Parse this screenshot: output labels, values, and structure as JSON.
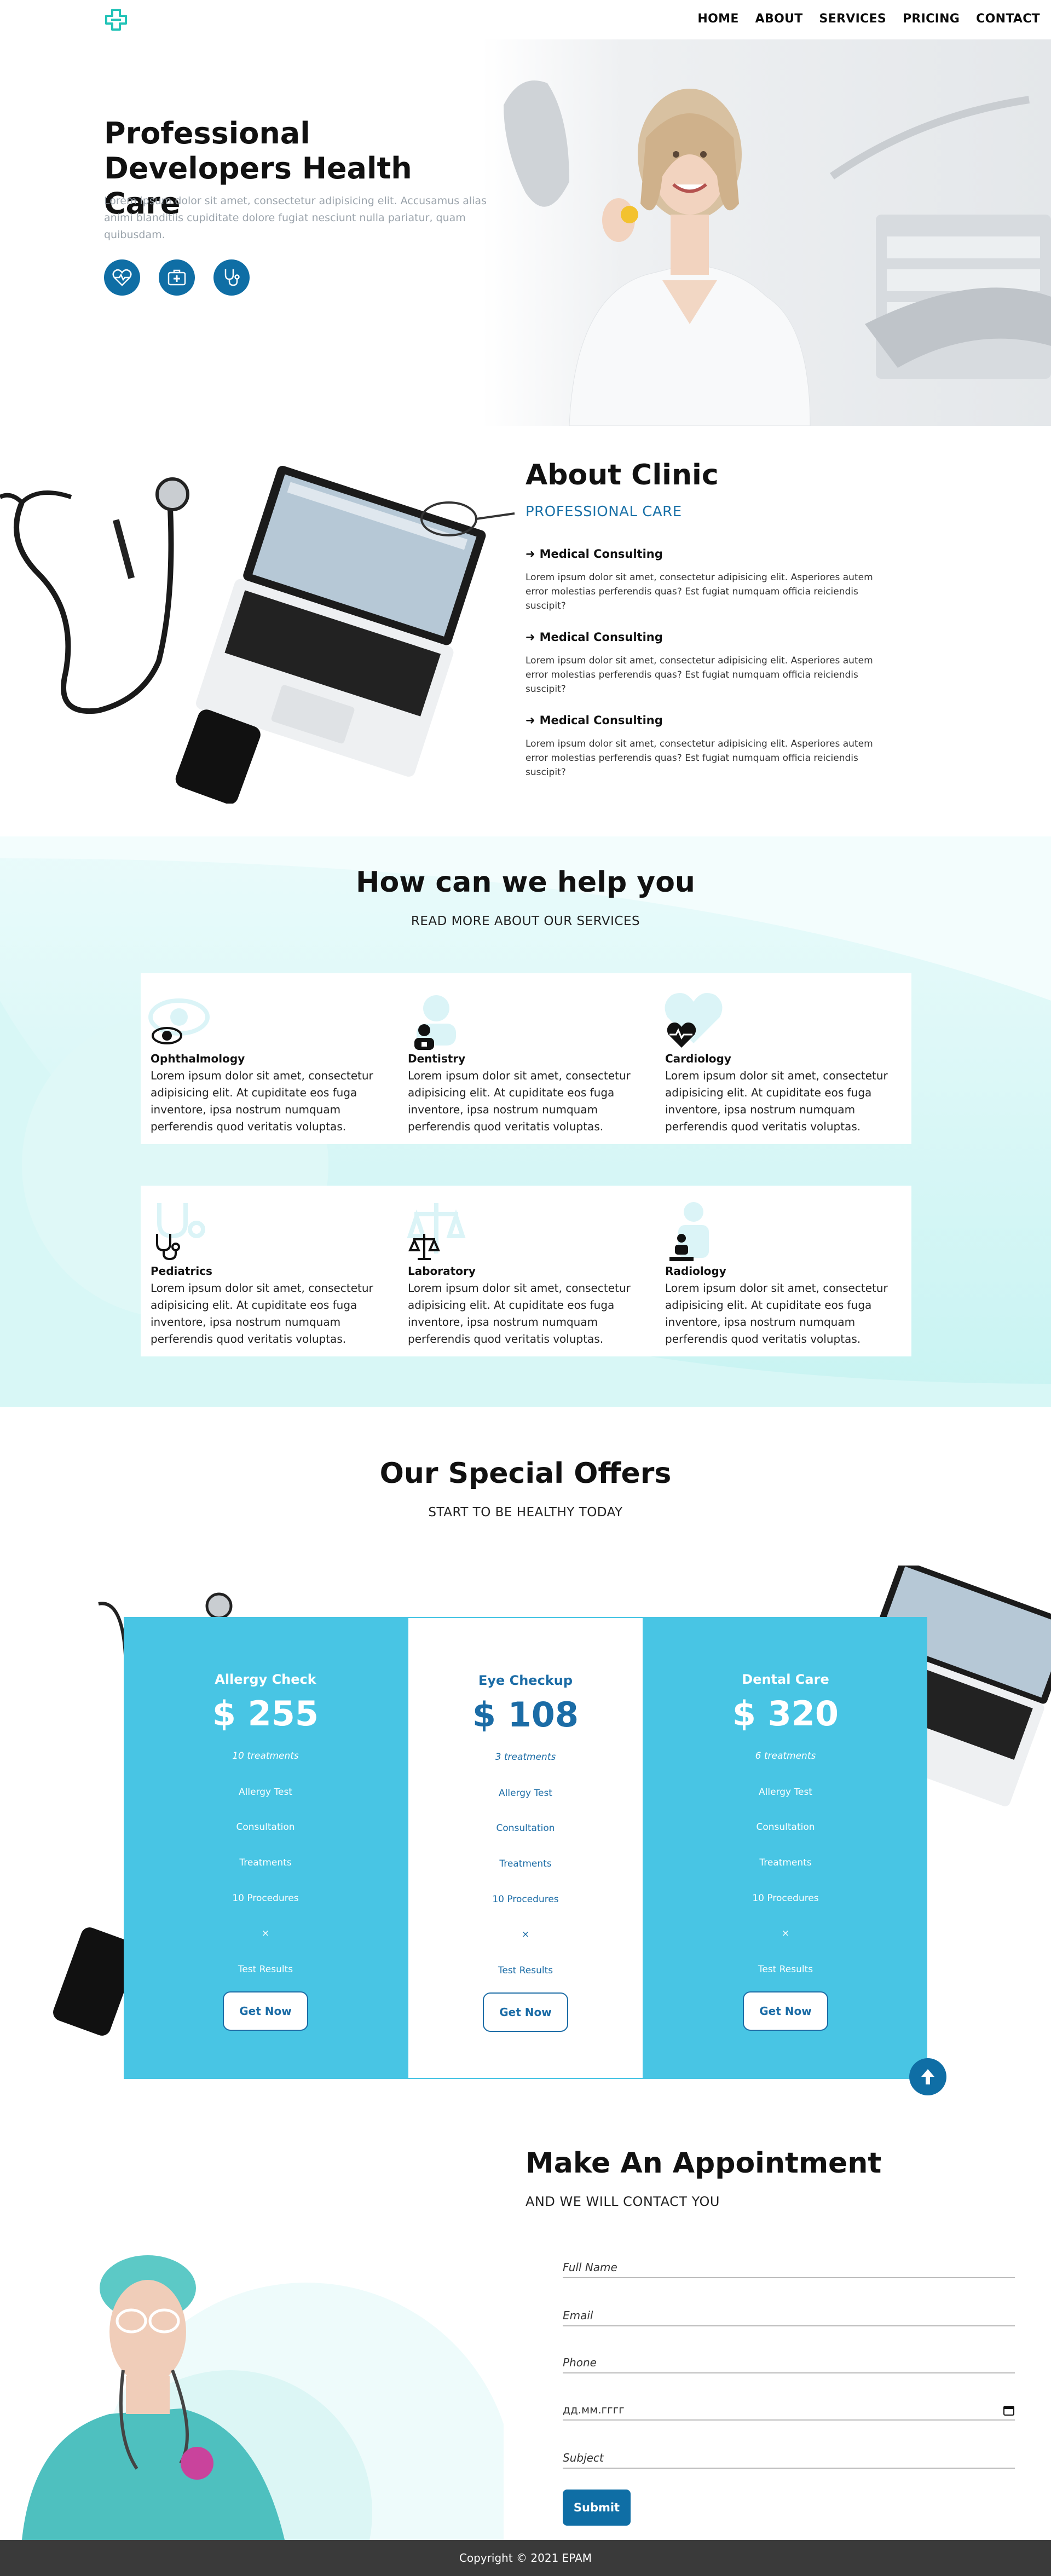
{
  "nav": {
    "logo_icon": "medical-cross-icon",
    "items": [
      "HOME",
      "ABOUT",
      "SERVICES",
      "PRICING",
      "CONTACT"
    ]
  },
  "hero": {
    "title": "Professional Developers Health Care",
    "text": "Lorem ipsum dolor sit amet, consectetur adipisicing elit. Accusamus alias animi blanditiis cupiditate dolore fugiat nesciunt nulla pariatur, quam quibusdam.",
    "icons": [
      "heart-rate-icon",
      "medical-kit-icon",
      "stethoscope-icon"
    ]
  },
  "about": {
    "title": "About Clinic",
    "subtitle": "PROFESSIONAL CARE",
    "items": [
      {
        "title": "Medical Consulting",
        "text": "Lorem ipsum dolor sit amet, consectetur adipisicing elit. Asperiores autem error molestias perferendis quas? Est fugiat numquam officia reiciendis suscipit?"
      },
      {
        "title": "Medical Consulting",
        "text": "Lorem ipsum dolor sit amet, consectetur adipisicing elit. Asperiores autem error molestias perferendis quas? Est fugiat numquam officia reiciendis suscipit?"
      },
      {
        "title": "Medical Consulting",
        "text": "Lorem ipsum dolor sit amet, consectetur adipisicing elit. Asperiores autem error molestias perferendis quas? Est fugiat numquam officia reiciendis suscipit?"
      }
    ]
  },
  "help": {
    "title": "How can we help you",
    "subtitle": "READ MORE ABOUT OUR SERVICES",
    "services": [
      {
        "name": "Ophthalmology",
        "icon": "eye-icon",
        "text": "Lorem ipsum dolor sit amet, consectetur adipisicing elit. At cupiditate eos fuga inventore, ipsa nostrum numquam perferendis quod veritatis voluptas."
      },
      {
        "name": "Dentistry",
        "icon": "dentist-icon",
        "text": "Lorem ipsum dolor sit amet, consectetur adipisicing elit. At cupiditate eos fuga inventore, ipsa nostrum numquam perferendis quod veritatis voluptas."
      },
      {
        "name": "Cardiology",
        "icon": "heartbeat-icon",
        "text": "Lorem ipsum dolor sit amet, consectetur adipisicing elit. At cupiditate eos fuga inventore, ipsa nostrum numquam perferendis quod veritatis voluptas."
      },
      {
        "name": "Pediatrics",
        "icon": "stethoscope-icon",
        "text": "Lorem ipsum dolor sit amet, consectetur adipisicing elit. At cupiditate eos fuga inventore, ipsa nostrum numquam perferendis quod veritatis voluptas."
      },
      {
        "name": "Laboratory",
        "icon": "balance-scale-icon",
        "text": "Lorem ipsum dolor sit amet, consectetur adipisicing elit. At cupiditate eos fuga inventore, ipsa nostrum numquam perferendis quod veritatis voluptas."
      },
      {
        "name": "Radiology",
        "icon": "x-ray-person-icon",
        "text": "Lorem ipsum dolor sit amet, consectetur adipisicing elit. At cupiditate eos fuga inventore, ipsa nostrum numquam perferendis quod veritatis voluptas."
      }
    ]
  },
  "offers": {
    "title": "Our Special Offers",
    "subtitle": "START TO BE HEALTHY TODAY",
    "plans": [
      {
        "name": "Allergy Check",
        "price": "$ 255",
        "treatments": "10 treatments",
        "lines": [
          "Allergy Test",
          "Consultation",
          "Treatments",
          "10 Procedures",
          "×",
          "Test Results"
        ],
        "button": "Get Now"
      },
      {
        "name": "Eye Checkup",
        "price": "$ 108",
        "treatments": "3 treatments",
        "lines": [
          "Allergy Test",
          "Consultation",
          "Treatments",
          "10 Procedures",
          "×",
          "Test Results"
        ],
        "button": "Get Now"
      },
      {
        "name": "Dental Care",
        "price": "$ 320",
        "treatments": "6 treatments",
        "lines": [
          "Allergy Test",
          "Consultation",
          "Treatments",
          "10 Procedures",
          "×",
          "Test Results"
        ],
        "button": "Get Now"
      }
    ],
    "scroll_top_icon": "arrow-up-icon"
  },
  "appointment": {
    "title": "Make An Appointment",
    "subtitle": "AND WE WILL CONTACT YOU",
    "fields": {
      "full_name": "Full Name",
      "email": "Email",
      "phone": "Phone",
      "date": "дд.мм.гггг",
      "subject": "Subject"
    },
    "submit": "Submit"
  },
  "footer": {
    "text": "Copyright © 2021 EPAM"
  },
  "colors": {
    "primary": "#0f6ea5",
    "accent": "#48c5e4",
    "mint": "#c8f3f2"
  }
}
